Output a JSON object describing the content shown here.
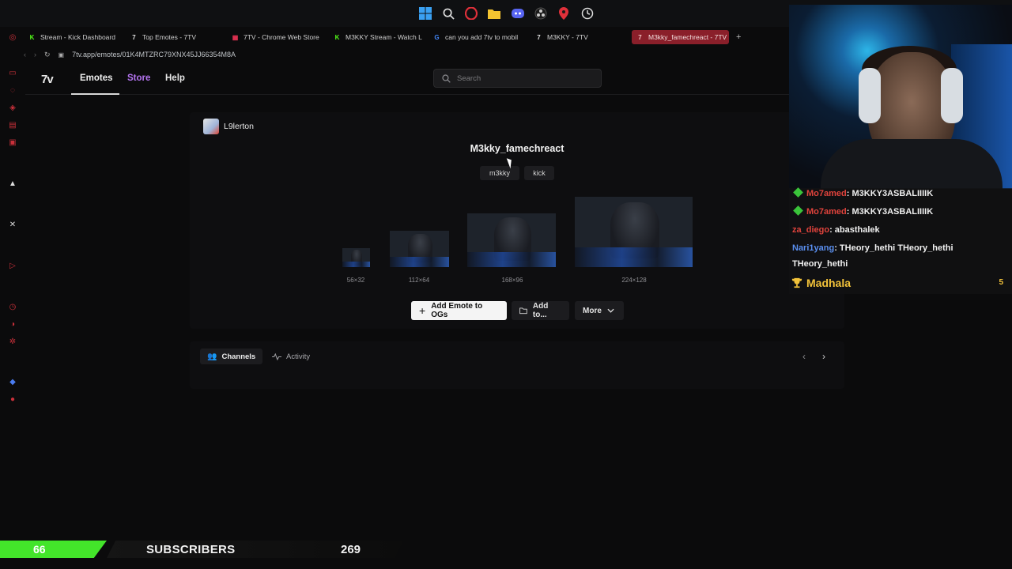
{
  "taskbar": {
    "icons": [
      "windows-icon",
      "search-icon",
      "opera-icon",
      "folder-icon",
      "discord-icon",
      "obs-icon",
      "maps-pin-icon",
      "clock-icon"
    ]
  },
  "browser": {
    "tabs": [
      {
        "label": "Stream - Kick Dashboard",
        "favicon": "K",
        "color": "#53fc18"
      },
      {
        "label": "Top Emotes - 7TV",
        "favicon": "7",
        "color": "#e0e0e0"
      },
      {
        "label": "7TV - Chrome Web Store",
        "favicon": "▦",
        "color": "#e35"
      },
      {
        "label": "M3KKY Stream - Watch L",
        "favicon": "K",
        "color": "#53fc18"
      },
      {
        "label": "can you add 7tv to mobil",
        "favicon": "G",
        "color": "#4285f4"
      },
      {
        "label": "M3KKY - 7TV",
        "favicon": "7",
        "color": "#e0e0e0"
      },
      {
        "label": "M3kky_famechreact - 7TV",
        "favicon": "7",
        "color": "#f0c0c0",
        "active": true
      }
    ],
    "new_tab": "+",
    "url": "7tv.app/emotes/01K4MTZRC79XNX45JJ66354M8A"
  },
  "nav": {
    "logo": "7v",
    "emotes": "Emotes",
    "store": "Store",
    "help": "Help",
    "search_placeholder": "Search"
  },
  "emote": {
    "owner": "L9lerton",
    "name": "M3kky_famechreact",
    "tags": [
      "m3kky",
      "kick"
    ],
    "sizes": [
      "56×32",
      "112×64",
      "168×96",
      "224×128"
    ],
    "add_button": "Add Emote to OGs",
    "add_to_button": "Add to...",
    "more_button": "More"
  },
  "detail_tabs": {
    "channels": "Channels",
    "activity": "Activity"
  },
  "chat": {
    "messages": [
      {
        "user": "Mo7amed",
        "text": ": M3KKY3ASBALIIIIK",
        "badge": true,
        "color": "red"
      },
      {
        "user": "Mo7amed",
        "text": ": M3KKY3ASBALIIIIK",
        "badge": true,
        "color": "red"
      },
      {
        "user": "za_diego",
        "text": ": abasthalek",
        "badge": false,
        "color": "red"
      },
      {
        "user": "Nari1yang",
        "text": ": THeory_hethi THeory_hethi",
        "badge": false,
        "color": "blue"
      },
      {
        "user": "",
        "text": "THeory_hethi",
        "badge": false,
        "color": "white"
      }
    ],
    "top_user": "Madhala",
    "top_count": "5"
  },
  "subscribers": {
    "current": "66",
    "label": "SUBSCRIBERS",
    "goal": "269",
    "progress": 0.245
  }
}
